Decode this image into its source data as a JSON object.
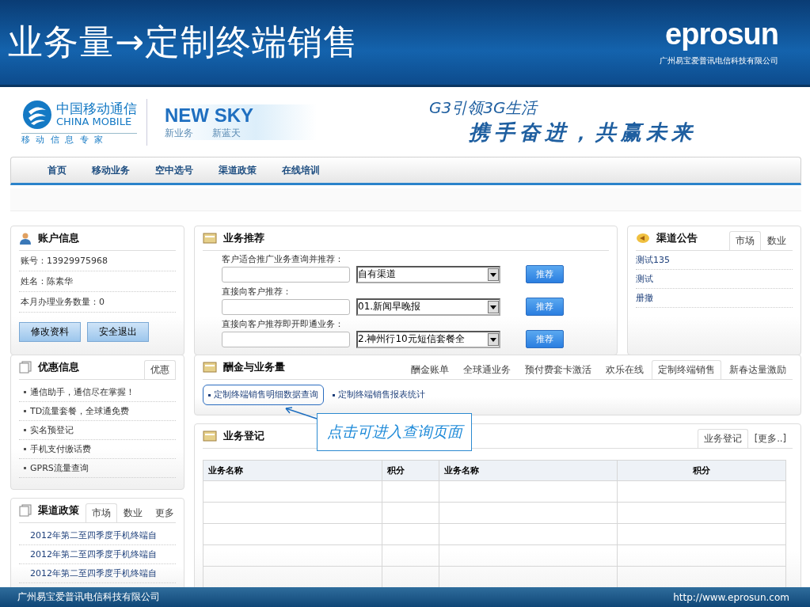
{
  "slide": {
    "title": "业务量→定制终端销售",
    "logo_text": "eprosun",
    "logo_company": "广州易宝爱普讯电信科技有限公司"
  },
  "banner": {
    "brand_cn": "中国移动通信",
    "brand_en": "CHINA MOBILE",
    "brand_tagline": "移 动 信 息 专 家",
    "product": "NEW SKY",
    "product_sub_1": "新业务",
    "product_sub_2": "新蓝天",
    "slogan_1": "G3引领3G生活",
    "slogan_2": "携手奋进，共赢未来"
  },
  "nav": [
    "首页",
    "移动业务",
    "空中选号",
    "渠道政策",
    "在线培训"
  ],
  "account": {
    "title": "账户信息",
    "rows": [
      "账号：13929975968",
      "姓名：陈素华",
      "本月办理业务数量：0"
    ],
    "buttons": [
      "修改资料",
      "安全退出"
    ]
  },
  "recommend": {
    "title": "业务推荐",
    "items": [
      {
        "label": "客户适合推广业务查询并推荐：",
        "value": "自有渠道",
        "button": "推荐"
      },
      {
        "label": "直接向客户推荐：",
        "value": "01.新闻早晚报",
        "button": "推荐"
      },
      {
        "label": "直接向客户推荐即开即通业务：",
        "value": "2.神州行10元短信套餐全",
        "button": "推荐"
      }
    ]
  },
  "notice": {
    "title": "渠道公告",
    "tabs": [
      {
        "label": "市场",
        "selected": true
      },
      {
        "label": "数业",
        "selected": false
      }
    ],
    "items": [
      "测试135",
      "测试",
      "册撤"
    ]
  },
  "promo": {
    "title": "优惠信息",
    "tabs": [
      {
        "label": "优惠",
        "selected": true
      }
    ],
    "items": [
      "通信助手，通信尽在掌握！",
      "TD流量套餐，全球通免费",
      "实名预登记",
      "手机支付缴话费",
      "GPRS流量查询"
    ]
  },
  "policy": {
    "title": "渠道政策",
    "tabs": [
      {
        "label": "市场",
        "selected": true
      },
      {
        "label": "数业",
        "selected": false
      },
      {
        "label": "更多",
        "selected": false
      }
    ],
    "items": [
      "2012年第二至四季度手机终端自",
      "2012年第二至四季度手机终端自",
      "2012年第二至四季度手机终端自"
    ]
  },
  "commission": {
    "title": "酬金与业务量",
    "tabs": [
      {
        "label": "酬金账单",
        "selected": false
      },
      {
        "label": "全球通业务",
        "selected": false
      },
      {
        "label": "预付费套卡激活",
        "selected": false
      },
      {
        "label": "欢乐在线",
        "selected": false
      },
      {
        "label": "定制终端销售",
        "selected": true
      },
      {
        "label": "新春达量激励",
        "selected": false
      }
    ],
    "links": [
      {
        "label": "定制终端销售明细数据查询",
        "highlighted": true
      },
      {
        "label": "定制终端销售报表统计",
        "highlighted": false
      }
    ]
  },
  "register": {
    "title": "业务登记",
    "tabs": [
      {
        "label": "业务登记",
        "selected": true
      },
      {
        "label": "[更多..]",
        "selected": false
      }
    ],
    "columns": [
      "业务名称",
      "积分",
      "业务名称",
      "积分"
    ]
  },
  "callout": {
    "text": "点击可进入查询页面"
  },
  "footer": {
    "company": "广州易宝爱普讯电信科技有限公司",
    "url": "http://www.eprosun.com"
  }
}
